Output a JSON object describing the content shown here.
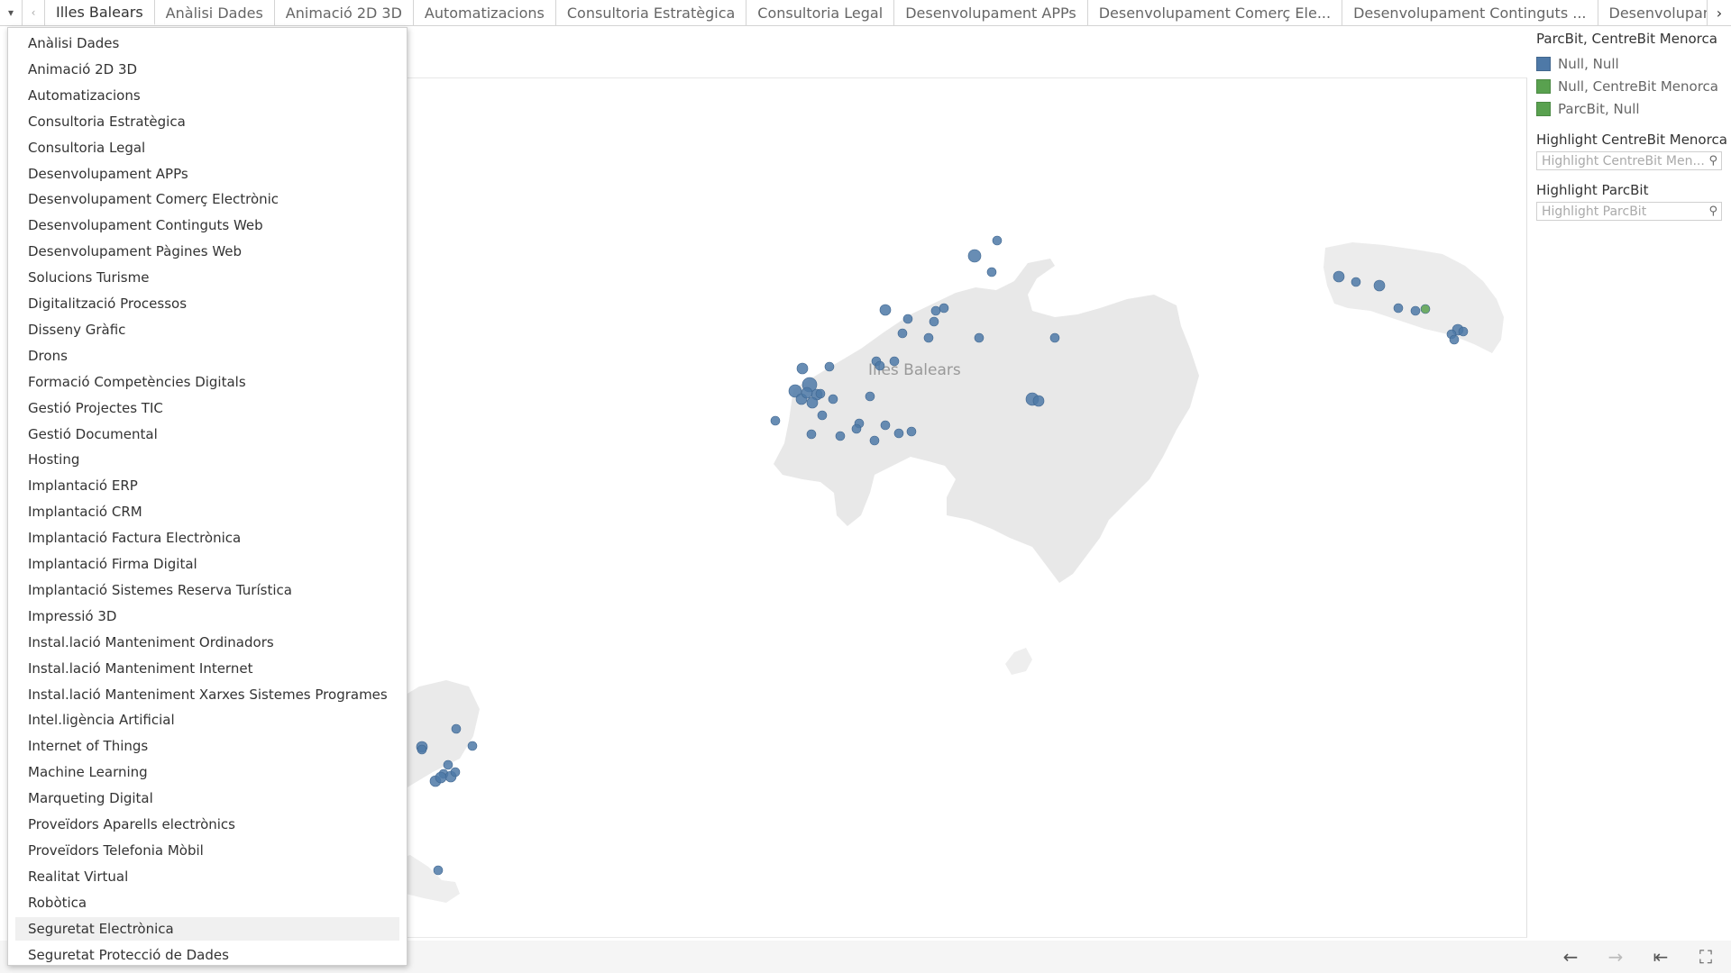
{
  "tabbar": {
    "tabs": [
      {
        "label": "Illes Balears",
        "active": true
      },
      {
        "label": "Anàlisi Dades"
      },
      {
        "label": "Animació 2D 3D"
      },
      {
        "label": "Automatizacions"
      },
      {
        "label": "Consultoria Estratègica"
      },
      {
        "label": "Consultoria Legal"
      },
      {
        "label": "Desenvolupament APPs"
      },
      {
        "label": "Desenvolupament Comerç Ele..."
      },
      {
        "label": "Desenvolupament Continguts ..."
      },
      {
        "label": "Desenvolupament Pà"
      }
    ]
  },
  "map": {
    "label": "Illes Balears"
  },
  "legend": {
    "title": "ParcBit, CentreBit Menorca",
    "items": [
      {
        "label": "Null, Null",
        "color": "#4e79a7"
      },
      {
        "label": "Null, CentreBit Menorca",
        "color": "#59a14f"
      },
      {
        "label": "ParcBit, Null",
        "color": "#59a14f"
      }
    ]
  },
  "highlight_centrebit": {
    "title": "Highlight CentreBit Menorca",
    "placeholder": "Highlight CentreBit Men..."
  },
  "highlight_parcbit": {
    "title": "Highlight ParcBit",
    "placeholder": "Highlight ParcBit"
  },
  "dropdown": {
    "items": [
      "Anàlisi Dades",
      "Animació 2D 3D",
      "Automatizacions",
      "Consultoria Estratègica",
      "Consultoria Legal",
      "Desenvolupament APPs",
      "Desenvolupament Comerç Electrònic",
      "Desenvolupament Continguts Web",
      "Desenvolupament Pàgines Web",
      "Solucions Turisme",
      "Digitalització Processos",
      "Disseny Gràfic",
      "Drons",
      "Formació Competències Digitals",
      "Gestió Projectes TIC",
      "Gestió Documental",
      "Hosting",
      "Implantació ERP",
      "Implantació CRM",
      "Implantació Factura Electrònica",
      "Implantació Firma Digital",
      "Implantació Sistemes Reserva Turística",
      "Impressió 3D",
      "Instal.lació Manteniment Ordinadors",
      "Instal.lació Manteniment Internet",
      "Instal.lació Manteniment Xarxes Sistemes Programes",
      "Intel.ligència Artificial",
      "Internet of Things",
      "Machine Learning",
      "Marqueting Digital",
      "Proveïdors Aparells electrònics",
      "Proveïdors Telefonia Mòbil",
      "Realitat Virtual",
      "Robòtica",
      "Seguretat Electrònica",
      "Seguretat Protecció de Dades"
    ],
    "hovered": "Seguretat Electrònica"
  },
  "icons": {
    "tab_menu": "chevron-down-icon",
    "tab_prev": "chevron-left-icon",
    "tab_next": "chevron-right-icon",
    "search": "search-icon",
    "undo": "arrow-left-icon",
    "redo": "arrow-right-icon",
    "revert": "revert-icon",
    "fullscreen": "fullscreen-icon"
  },
  "colors": {
    "point_default": "#4e79a7",
    "point_highlight": "#59a14f",
    "land": "#e8e8e8"
  }
}
